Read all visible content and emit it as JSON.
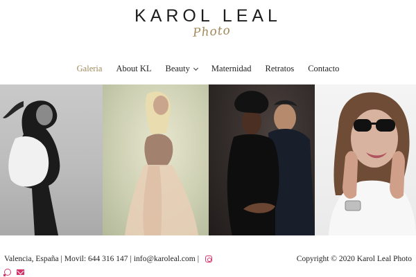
{
  "header": {
    "logo_text": "KAROL LEAL",
    "logo_script": "Photo"
  },
  "nav": {
    "items": [
      {
        "label": "Galeria",
        "active": true
      },
      {
        "label": "About KL"
      },
      {
        "label": "Beauty",
        "has_dropdown": true
      },
      {
        "label": "Maternidad"
      },
      {
        "label": "Retratos"
      },
      {
        "label": "Contacto"
      }
    ]
  },
  "gallery": {
    "photos": [
      {
        "name": "maternity-photo-black-and-white",
        "tone": "grayscale"
      },
      {
        "name": "maternity-photo-tulle-dress",
        "tone": "pastel"
      },
      {
        "name": "couple-maternity-photo",
        "tone": "dark"
      },
      {
        "name": "portrait-woman-sunglasses",
        "tone": "light"
      }
    ]
  },
  "footer": {
    "location": "Valencia, España",
    "phone": "Movil: 644 316 147",
    "email": "info@karoleal.com",
    "separator": "|",
    "copyright": "Copyright © 2020 Karol Leal Photo",
    "icons": [
      "instagram-icon",
      "whatsapp-icon",
      "mail-icon"
    ],
    "accent_color": "#d6336c"
  },
  "colors": {
    "nav_active": "#a08a5b",
    "text": "#222222",
    "background": "#ffffff"
  }
}
